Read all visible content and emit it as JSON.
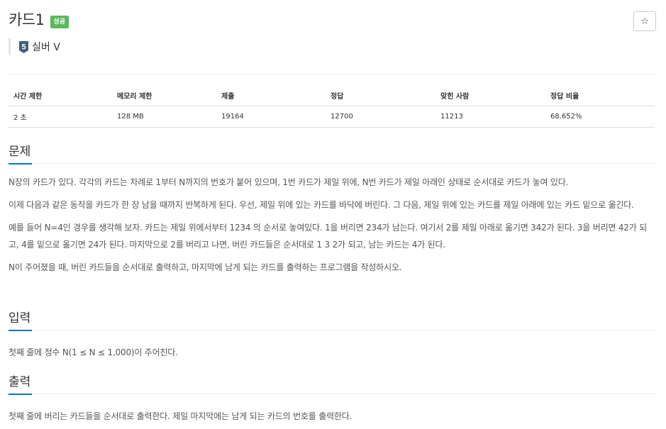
{
  "problem": {
    "title": "카드1",
    "status_badge": "성공",
    "tier_number": "5",
    "tier_label": "실버 V",
    "star_symbol": "☆",
    "colors": {
      "success": "#5cb85c",
      "accent_underline": "#0076c0",
      "tier_badge": "#435f7a"
    }
  },
  "stats": {
    "headers": [
      "시간 제한",
      "메모리 제한",
      "제출",
      "정답",
      "맞힌 사람",
      "정답 비율"
    ],
    "values": [
      "2 초",
      "128 MB",
      "19164",
      "12700",
      "11213",
      "68.652%"
    ]
  },
  "sections": {
    "description": {
      "title": "문제",
      "paragraphs": [
        "N장의 카드가 있다. 각각의 카드는 차례로 1부터 N까지의 번호가 붙어 있으며, 1번 카드가 제일 위에, N번 카드가 제일 아래인 상태로 순서대로 카드가 놓여 있다.",
        "이제 다음과 같은 동작을 카드가 한 장 남을 때까지 반복하게 된다. 우선, 제일 위에 있는 카드를 바닥에 버린다. 그 다음, 제일 위에 있는 카드를 제일 아래에 있는 카드 밑으로 옮긴다.",
        "예를 들어 N=4인 경우를 생각해 보자. 카드는 제일 위에서부터 1234 의 순서로 놓여있다. 1을 버리면 234가 남는다. 여기서 2를 제일 아래로 옮기면 342가 된다. 3을 버리면 42가 되고, 4를 밑으로 옮기면 24가 된다. 마지막으로 2를 버리고 나면, 버린 카드들은 순서대로 1 3 2가 되고, 남는 카드는 4가 된다.",
        "N이 주어졌을 때, 버린 카드들을 순서대로 출력하고, 마지막에 남게 되는 카드를 출력하는 프로그램을 작성하시오."
      ]
    },
    "input": {
      "title": "입력",
      "paragraphs": [
        "첫째 줄에 정수 N(1 ≤ N ≤ 1,000)이 주어진다."
      ]
    },
    "output": {
      "title": "출력",
      "paragraphs": [
        "첫째 줄에 버리는 카드들을 순서대로 출력한다. 제일 마지막에는 남게 되는 카드의 번호를 출력한다."
      ]
    }
  }
}
